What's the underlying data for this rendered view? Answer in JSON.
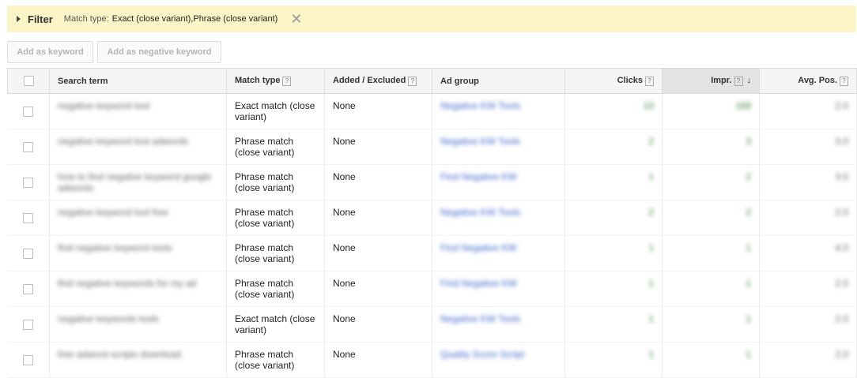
{
  "filter": {
    "label": "Filter",
    "match_type_label": "Match type:",
    "match_type_value": "Exact (close variant),Phrase (close variant)",
    "close_icon": "✕"
  },
  "toolbar": {
    "add_keyword": "Add as keyword",
    "add_negative": "Add as negative keyword"
  },
  "columns": {
    "search_term": "Search term",
    "match_type": "Match type",
    "added_excluded": "Added / Excluded",
    "ad_group": "Ad group",
    "clicks": "Clicks",
    "impr": "Impr.",
    "avg_pos": "Avg. Pos.",
    "help": "?",
    "sort_arrow": "↓"
  },
  "rows": [
    {
      "term": "negative keyword tool",
      "match": "Exact match (close variant)",
      "added": "None",
      "group": "Negative KW Tools",
      "clicks": "10",
      "impr": "169",
      "pos": "2.0"
    },
    {
      "term": "negative keyword tool adwords",
      "match": "Phrase match (close variant)",
      "added": "None",
      "group": "Negative KW Tools",
      "clicks": "2",
      "impr": "3",
      "pos": "3.0"
    },
    {
      "term": "how to find negative keyword google adwords",
      "match": "Phrase match (close variant)",
      "added": "None",
      "group": "Find Negative KW",
      "clicks": "1",
      "impr": "2",
      "pos": "3.5"
    },
    {
      "term": "negative keyword tool free",
      "match": "Phrase match (close variant)",
      "added": "None",
      "group": "Negative KW Tools",
      "clicks": "2",
      "impr": "2",
      "pos": "2.0"
    },
    {
      "term": "find negative keyword tools",
      "match": "Phrase match (close variant)",
      "added": "None",
      "group": "Find Negative KW",
      "clicks": "1",
      "impr": "1",
      "pos": "4.0"
    },
    {
      "term": "find negative keywords for my ad",
      "match": "Phrase match (close variant)",
      "added": "None",
      "group": "Find Negative KW",
      "clicks": "1",
      "impr": "1",
      "pos": "2.0"
    },
    {
      "term": "negative keywords tools",
      "match": "Exact match (close variant)",
      "added": "None",
      "group": "Negative KW Tools",
      "clicks": "1",
      "impr": "1",
      "pos": "2.0"
    },
    {
      "term": "free adword scripts download",
      "match": "Phrase match (close variant)",
      "added": "None",
      "group": "Quality Score Script",
      "clicks": "1",
      "impr": "1",
      "pos": "2.0"
    }
  ]
}
